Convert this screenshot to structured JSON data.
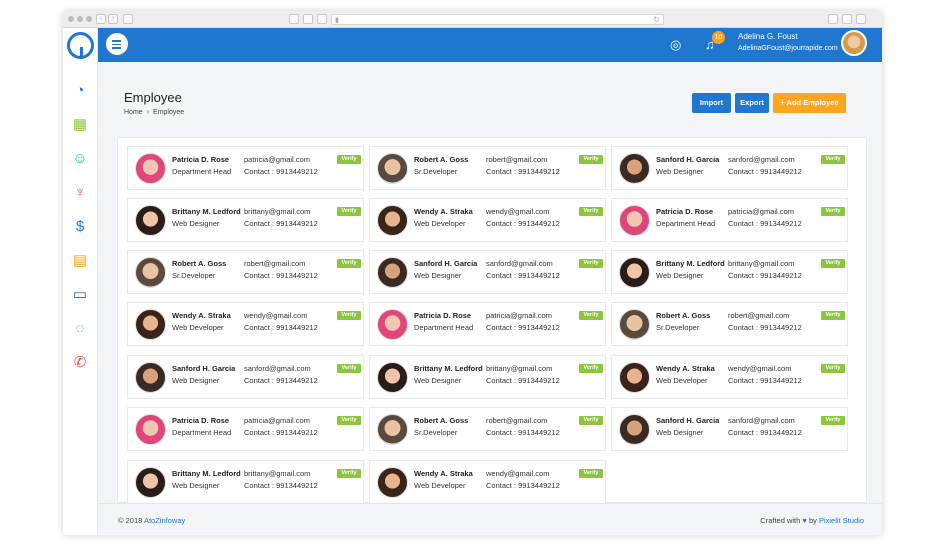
{
  "header": {
    "notifications_count": "10",
    "user_name": "Adelina G. Foust",
    "user_email": "AdelinaGFoust@jourrapide.com"
  },
  "page": {
    "title": "Employee",
    "breadcrumb": [
      "Home",
      "Employee"
    ],
    "buttons": {
      "import": "Import",
      "export": "Export",
      "add": "+ Add Employee"
    }
  },
  "sidebar": {
    "icons": [
      "dashboard-icon",
      "calendar-icon",
      "users-icon",
      "handshake-icon",
      "billing-icon",
      "presentation-icon",
      "payments-icon",
      "chat-icon",
      "support-icon"
    ]
  },
  "employees": [
    {
      "name": "Patricia D. Rose",
      "role": "Department Head",
      "email": "patricia@gmail.com",
      "contact": "Contact : 9913449212",
      "verify": "Verify"
    },
    {
      "name": "Robert A. Goss",
      "role": "Sr.Developer",
      "email": "robert@gmail.com",
      "contact": "Contact : 9913449212",
      "verify": "Verify"
    },
    {
      "name": "Sanford H. Garcia",
      "role": "Web Designer",
      "email": "sanford@gmail.com",
      "contact": "Contact : 9913449212",
      "verify": "Verify"
    },
    {
      "name": "Brittany M. Ledford",
      "role": "Web Designer",
      "email": "brittany@gmail.com",
      "contact": "Contact : 9913449212",
      "verify": "Verify"
    },
    {
      "name": "Wendy A. Straka",
      "role": "Web Developer",
      "email": "wendy@gmail.com",
      "contact": "Contact : 9913449212",
      "verify": "Verify"
    },
    {
      "name": "Patricia D. Rose",
      "role": "Department Head",
      "email": "patricia@gmail.com",
      "contact": "Contact : 9913449212",
      "verify": "Verify"
    },
    {
      "name": "Robert A. Goss",
      "role": "Sr.Developer",
      "email": "robert@gmail.com",
      "contact": "Contact : 9913449212",
      "verify": "Verify"
    },
    {
      "name": "Sanford H. Garcia",
      "role": "Web Designer",
      "email": "sanford@gmail.com",
      "contact": "Contact : 9913449212",
      "verify": "Verify"
    },
    {
      "name": "Brittany M. Ledford",
      "role": "Web Designer",
      "email": "brittany@gmail.com",
      "contact": "Contact : 9913449212",
      "verify": "Verify"
    },
    {
      "name": "Wendy A. Straka",
      "role": "Web Developer",
      "email": "wendy@gmail.com",
      "contact": "Contact : 9913449212",
      "verify": "Verify"
    },
    {
      "name": "Patricia D. Rose",
      "role": "Department Head",
      "email": "patricia@gmail.com",
      "contact": "Contact : 9913449212",
      "verify": "Verify"
    },
    {
      "name": "Robert A. Goss",
      "role": "Sr.Developer",
      "email": "robert@gmail.com",
      "contact": "Contact : 9913449212",
      "verify": "Verify"
    },
    {
      "name": "Sanford H. Garcia",
      "role": "Web Designer",
      "email": "sanford@gmail.com",
      "contact": "Contact : 9913449212",
      "verify": "Verify"
    },
    {
      "name": "Brittany M. Ledford",
      "role": "Web Designer",
      "email": "brittany@gmail.com",
      "contact": "Contact : 9913449212",
      "verify": "Verify"
    },
    {
      "name": "Wendy A. Straka",
      "role": "Web Developer",
      "email": "wendy@gmail.com",
      "contact": "Contact : 9913449212",
      "verify": "Verify"
    },
    {
      "name": "Patricia D. Rose",
      "role": "Department Head",
      "email": "patricia@gmail.com",
      "contact": "Contact : 9913449212",
      "verify": "Verify"
    },
    {
      "name": "Robert A. Goss",
      "role": "Sr.Developer",
      "email": "robert@gmail.com",
      "contact": "Contact : 9913449212",
      "verify": "Verify"
    },
    {
      "name": "Sanford H. Garcia",
      "role": "Web Designer",
      "email": "sanford@gmail.com",
      "contact": "Contact : 9913449212",
      "verify": "Verify"
    },
    {
      "name": "Brittany M. Ledford",
      "role": "Web Designer",
      "email": "brittany@gmail.com",
      "contact": "Contact : 9913449212",
      "verify": "Verify"
    },
    {
      "name": "Wendy A. Straka",
      "role": "Web Developer",
      "email": "wendy@gmail.com",
      "contact": "Contact : 9913449212",
      "verify": "Verify"
    }
  ],
  "footer": {
    "copyright": "© 2018",
    "brand": "AtoZinfoway",
    "crafted": "Crafted with",
    "heart": "♥",
    "by": "by",
    "studio": "Pixielit Studio"
  },
  "colors": {
    "primary": "#1f77d0",
    "accent": "#ffa51f",
    "verify": "#8cc63f"
  }
}
